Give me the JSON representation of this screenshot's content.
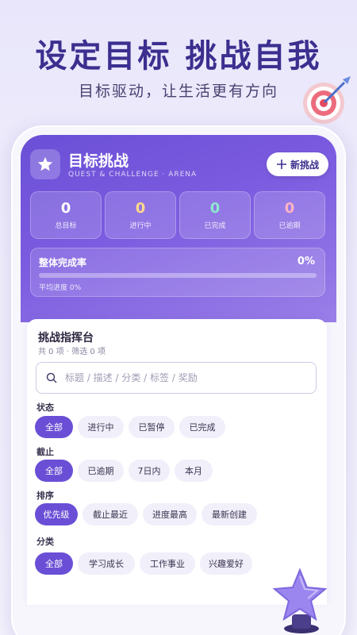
{
  "promo": {
    "title": "设定目标 挑战自我",
    "subtitle": "目标驱动，让生活更有方向"
  },
  "header": {
    "app_icon": "star-icon",
    "title": "目标挑战",
    "subtitle": "QUEST & CHALLENGE · ARENA",
    "new_button": "新挑战",
    "new_button_icon": "plus-icon"
  },
  "stats": [
    {
      "value": "0",
      "label": "总目标",
      "color": "#ffffff"
    },
    {
      "value": "0",
      "label": "进行中",
      "color": "#ffd98a"
    },
    {
      "value": "0",
      "label": "已完成",
      "color": "#8de8d0"
    },
    {
      "value": "0",
      "label": "已逾期",
      "color": "#ffb3c4"
    }
  ],
  "progress": {
    "label": "整体完成率",
    "value": "0%",
    "fraction": 0,
    "average": "平均进度 0%"
  },
  "console": {
    "title": "挑战指挥台",
    "count": "共 0 项 · 筛选 0 项",
    "search_placeholder": "标题 / 描述 / 分类 / 标签 / 奖励",
    "search_icon": "search-icon"
  },
  "filters": {
    "status": {
      "label": "状态",
      "options": [
        "全部",
        "进行中",
        "已暂停",
        "已完成"
      ],
      "selected": "全部"
    },
    "deadline": {
      "label": "截止",
      "options": [
        "全部",
        "已逾期",
        "7日内",
        "本月"
      ],
      "selected": "全部"
    },
    "sort": {
      "label": "排序",
      "options": [
        "优先级",
        "截止最近",
        "进度最高",
        "最新创建"
      ],
      "selected": "优先级"
    },
    "category": {
      "label": "分类",
      "options": [
        "全部",
        "学习成长",
        "工作事业",
        "兴趣爱好"
      ],
      "selected": "全部"
    }
  },
  "colors": {
    "accent": "#6a4fd6",
    "title": "#3b2f8f"
  }
}
